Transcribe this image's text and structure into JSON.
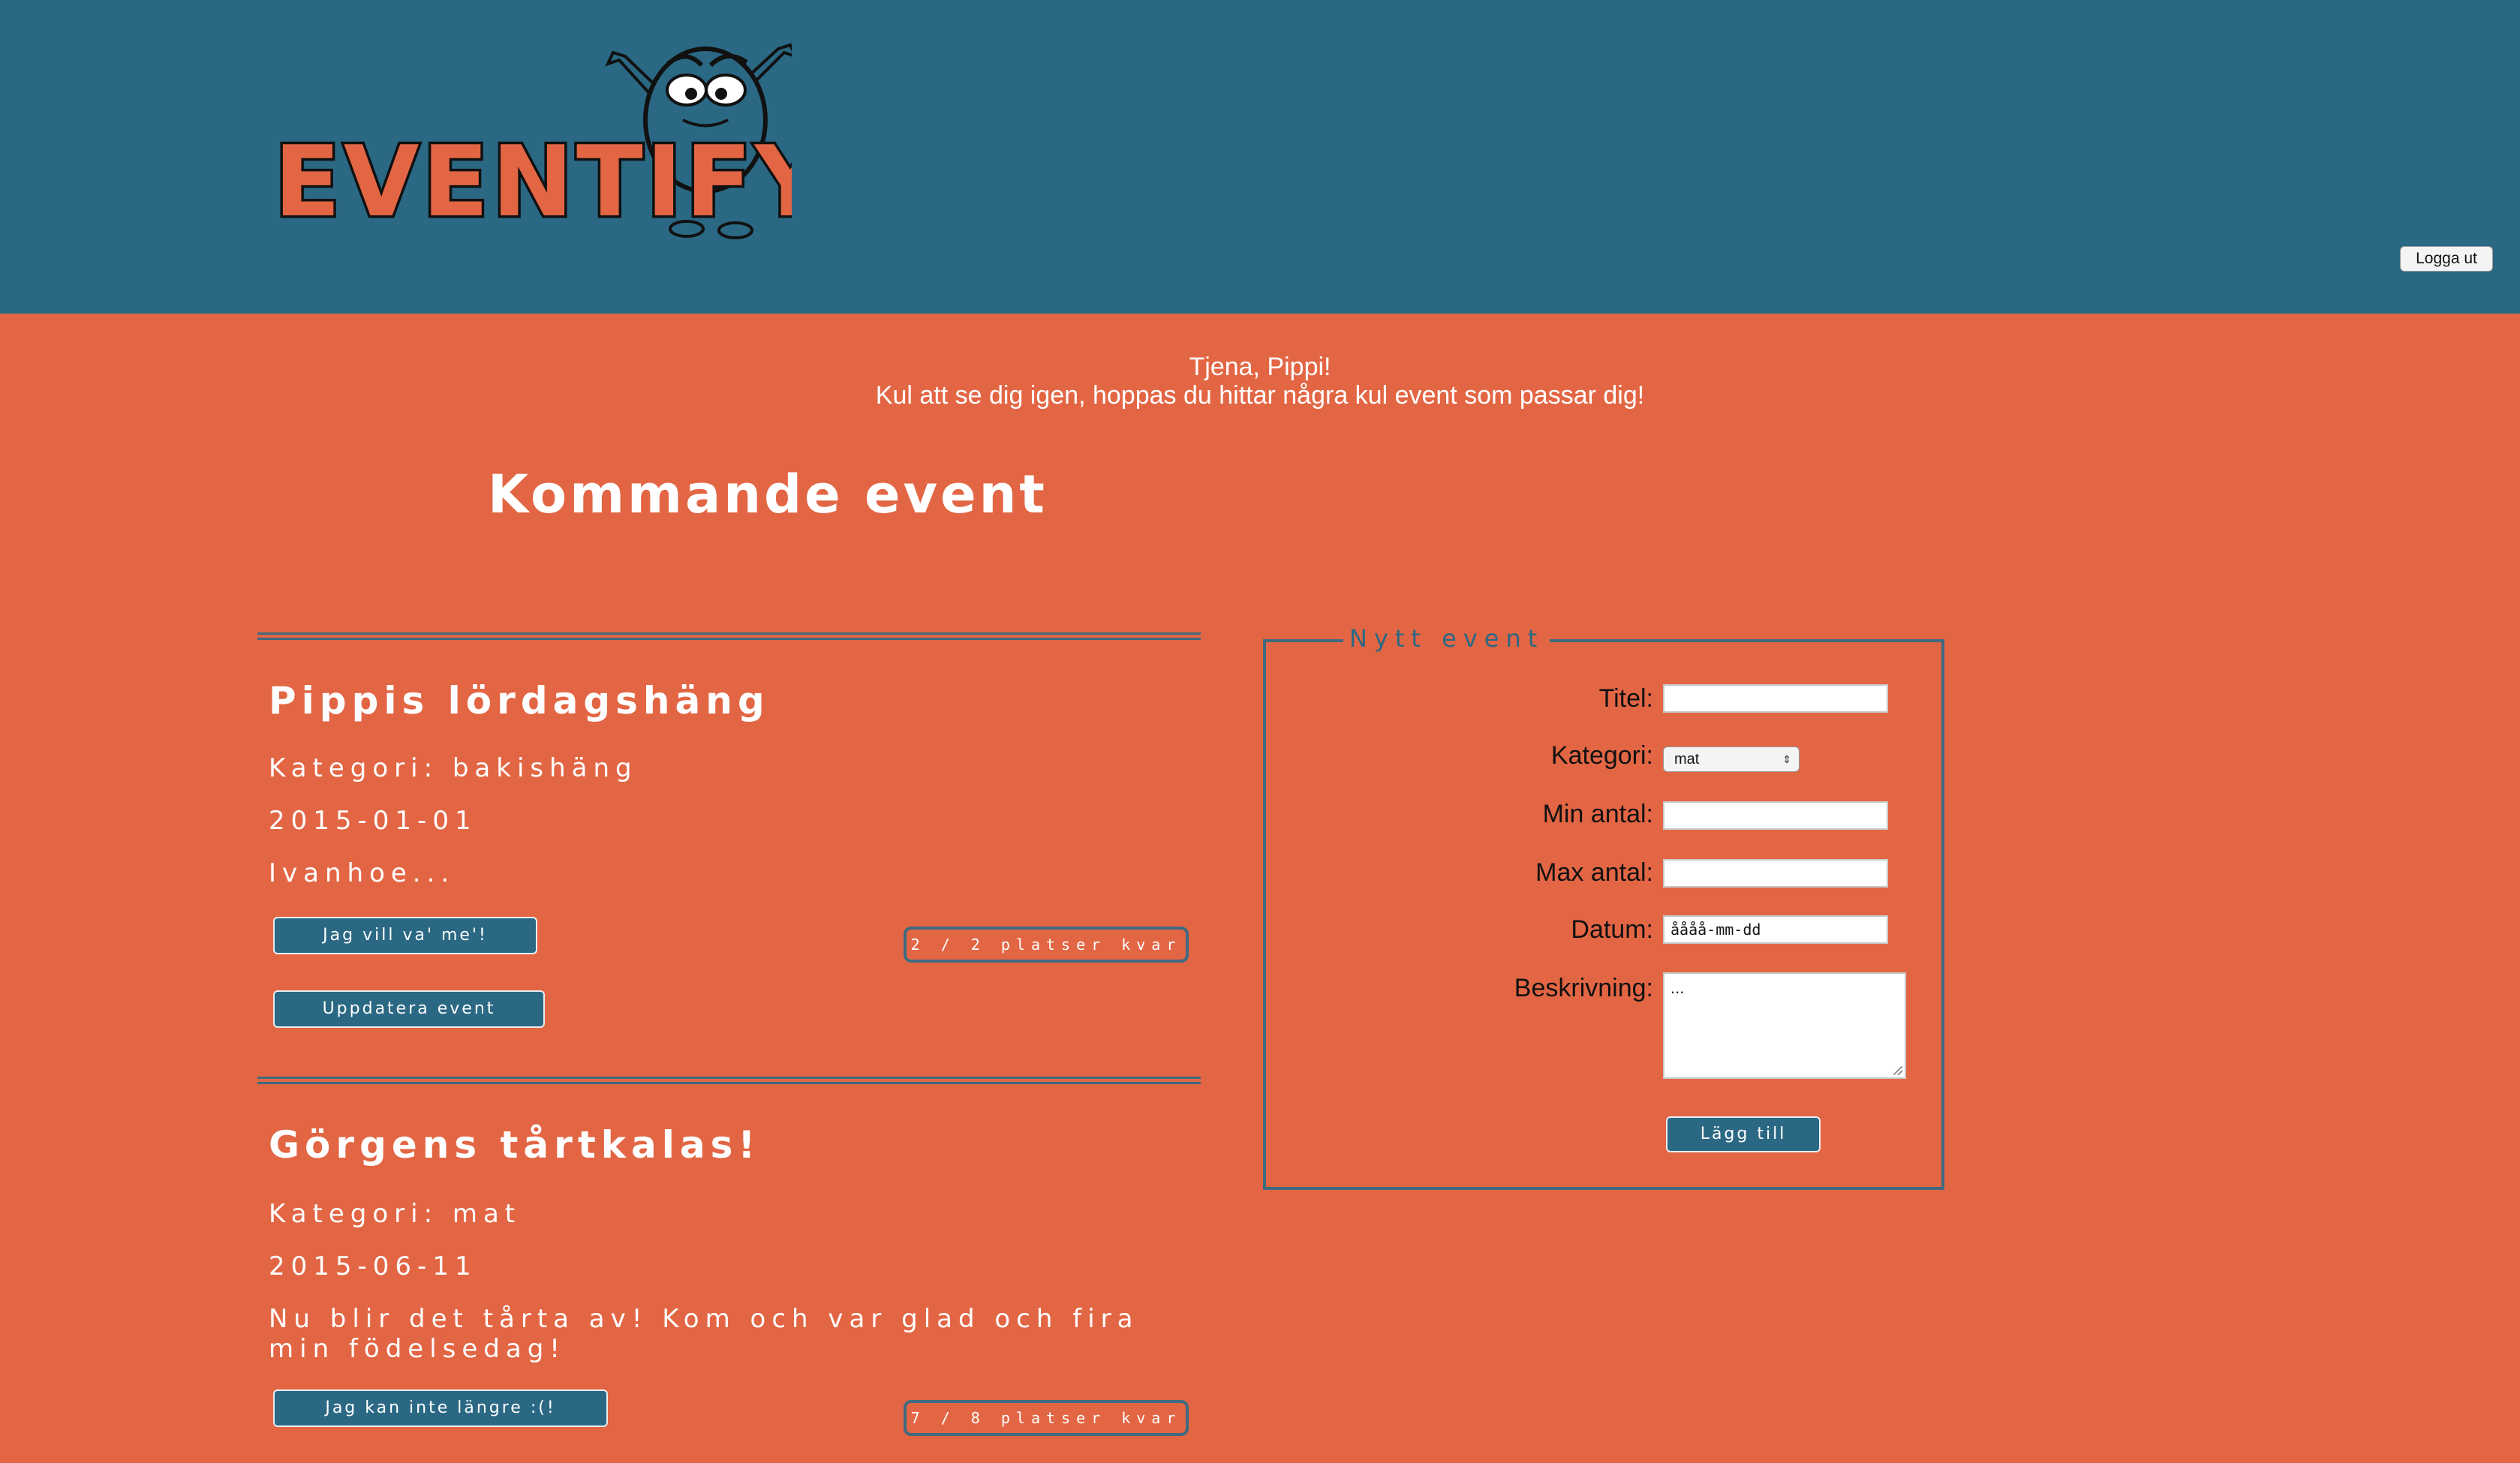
{
  "header": {
    "logo_text": "EVENTIFY",
    "logout_label": "Logga ut"
  },
  "greeting": {
    "line1": "Tjena, Pippi!",
    "line2": "Kul att se dig igen, hoppas du hittar några kul event som passar dig!"
  },
  "events_section": {
    "title": "Kommande event",
    "events": [
      {
        "title": "Pippis lördagshäng",
        "category": "Kategori: bakishäng",
        "date": "2015-01-01",
        "description": "Ivanhoe...",
        "join_label": "Jag vill va' me'!",
        "update_label": "Uppdatera event",
        "spots": "2 / 2 platser kvar"
      },
      {
        "title": "Görgens tårtkalas!",
        "category": "Kategori: mat",
        "date": "2015-06-11",
        "description": "Nu blir det tårta av! Kom och var glad och fira min födelsedag!",
        "join_label": "Jag kan inte längre :(!",
        "spots": "7 / 8 platser kvar"
      }
    ]
  },
  "new_event_form": {
    "legend": "Nytt event",
    "labels": {
      "title": "Titel:",
      "category": "Kategori:",
      "min": "Min antal:",
      "max": "Max antal:",
      "date": "Datum:",
      "description": "Beskrivning:"
    },
    "values": {
      "title": "",
      "category": "mat",
      "min": "",
      "max": "",
      "date": "åååå-mm-dd",
      "description": "..."
    },
    "submit_label": "Lägg till"
  },
  "colors": {
    "header_bg": "#2b6884",
    "page_bg": "#e36644",
    "button_bg": "#2b6884",
    "border": "#3f6a80"
  }
}
